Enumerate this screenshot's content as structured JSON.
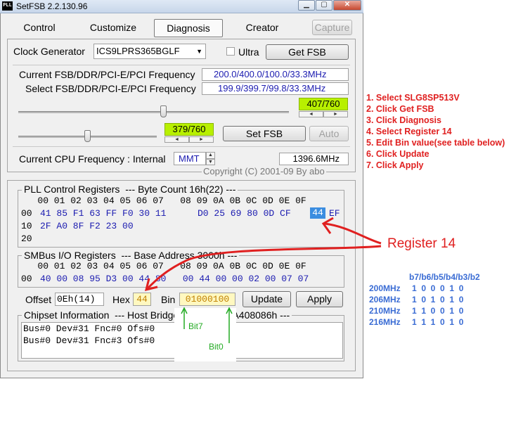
{
  "window": {
    "title": "SetFSB 2.2.130.96",
    "app_icon": "PLL",
    "caption_buttons": [
      "minimize-icon",
      "maximize-icon",
      "close-icon"
    ]
  },
  "tabs": [
    {
      "label": "Control",
      "active": false
    },
    {
      "label": "Customize",
      "active": false
    },
    {
      "label": "Diagnosis",
      "active": true
    },
    {
      "label": "Creator",
      "active": false
    }
  ],
  "capture_label": "Capture",
  "clock_generator": {
    "label": "Clock Generator",
    "value": "ICS9LPRS365BGLF",
    "ultra_label": "Ultra",
    "ultra_checked": false,
    "get_fsb_label": "Get FSB"
  },
  "freq": {
    "current_label": "Current FSB/DDR/PCI-E/PCI Frequency",
    "current_value": "200.0/400.0/100.0/33.3MHz",
    "select_label": "Select FSB/DDR/PCI-E/PCI Frequency",
    "select_value": "199.9/399.7/99.8/33.3MHz",
    "slider1_display": "407/760",
    "slider1_fraction": 0.535,
    "slider2_display": "379/760",
    "slider2_fraction": 0.499,
    "set_fsb_label": "Set FSB",
    "auto_label": "Auto",
    "cpu_label": "Current CPU Frequency : Internal",
    "cpu_mode": "MMT",
    "cpu_value": "1396.6MHz",
    "copyright": "Copyright (C) 2001-09 By abo"
  },
  "pll": {
    "title": "PLL Control Registers  --- Byte Count 16h(22) ---",
    "header": "   00 01 02 03 04 05 06 07   08 09 0A 0B 0C 0D 0E 0F",
    "rows": [
      {
        "addr": "00",
        "bytes_a": "41 85 F1 63 FF F0 30 11",
        "bytes_b": "D0 25 69 80 0D CF",
        "selected": "44",
        "tail": "EF"
      },
      {
        "addr": "10",
        "bytes_a": "2F A0 8F F2 23 00",
        "bytes_b": "",
        "selected": "",
        "tail": ""
      },
      {
        "addr": "20",
        "bytes_a": "",
        "bytes_b": "",
        "selected": "",
        "tail": ""
      }
    ]
  },
  "smbus": {
    "title": "SMBus I/O Registers  --- Base Address 3000h ---",
    "header": "   00 01 02 03 04 05 06 07   08 09 0A 0B 0C 0D 0E 0F",
    "row_addr": "00",
    "row_bytes": "40 00 08 95 D3 00 44 80   00 44 00 00 02 00 07 07"
  },
  "editor": {
    "offset_label": "Offset",
    "offset_value": "0Eh(14)",
    "hex_label": "Hex",
    "hex_value": "44",
    "bin_label": "Bin",
    "bin_value": "01000100",
    "update_label": "Update",
    "apply_label": "Apply"
  },
  "chipset": {
    "title": "Chipset Information  --- Host Bridge Controller 2A408086h ---",
    "lines": [
      "Bus#0 Dev#31 Fnc#0 Ofs#0          6h",
      "Bus#0 Dev#31 Fnc#3 Ofs#0          6h"
    ]
  },
  "annotations": {
    "instructions": [
      "1. Select SLG8SP513V",
      "2. Click Get FSB",
      "3. Click Diagnosis",
      "4. Select Register 14",
      "5. Edit Bin value(see table below)",
      "6. Click Update",
      "7. Click Apply"
    ],
    "register_label": "Register 14",
    "bit7_label": "Bit7",
    "bit0_label": "Bit0",
    "table_header": "b7/b6/b5/b4/b3/b2",
    "table_rows": [
      {
        "freq": "200MHz",
        "bits": "1  0  0  0  1  0"
      },
      {
        "freq": "206MHz",
        "bits": "1  0  1  0  1  0"
      },
      {
        "freq": "210MHz",
        "bits": "1  1  0  0  1  0"
      },
      {
        "freq": "216MHz",
        "bits": "1  1  1  0  1  0"
      }
    ],
    "colors": {
      "instructions": "#e02020",
      "arrow": "#e02020",
      "table": "#3a6cd4",
      "bit_arrows": "#22aa22"
    }
  }
}
